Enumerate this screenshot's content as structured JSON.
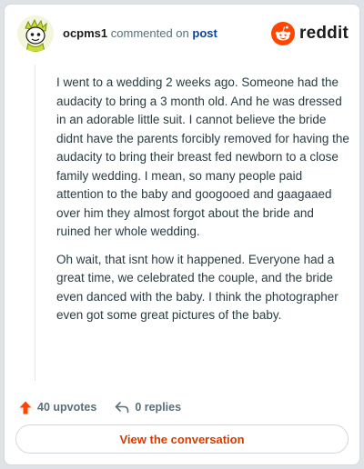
{
  "comment": {
    "author": "ocpms1",
    "action": "commented on",
    "target_link": "post",
    "paragraphs": [
      "I went to a wedding 2 weeks ago. Someone had the audacity to bring a 3 month old. And he was dressed in an adorable little suit. I cannot believe the bride didnt have the parents forcibly removed for having the audacity to bring their breast fed newborn to a close family wedding. I mean, so many people paid attention to the baby and googooed and gaagaaed over him they almost forgot about the bride and ruined her whole wedding.",
      "Oh wait, that isnt how it happened. Everyone had a great time, we celebrated the couple, and the bride even danced with the baby. I think the photographer even got some great pictures of the baby."
    ]
  },
  "brand": {
    "wordmark": "reddit",
    "icon": "reddit-snoo-icon",
    "color": "#ff4500"
  },
  "stats": {
    "upvotes_label": "40 upvotes",
    "upvote_icon": "upvote-arrow-icon",
    "replies_label": "0 replies",
    "reply_icon": "reply-arrow-icon"
  },
  "cta": {
    "label": "View the conversation",
    "color": "#d93a00"
  },
  "colors": {
    "link": "#0a449b",
    "muted": "#576f76",
    "upvote": "#ff4500"
  }
}
